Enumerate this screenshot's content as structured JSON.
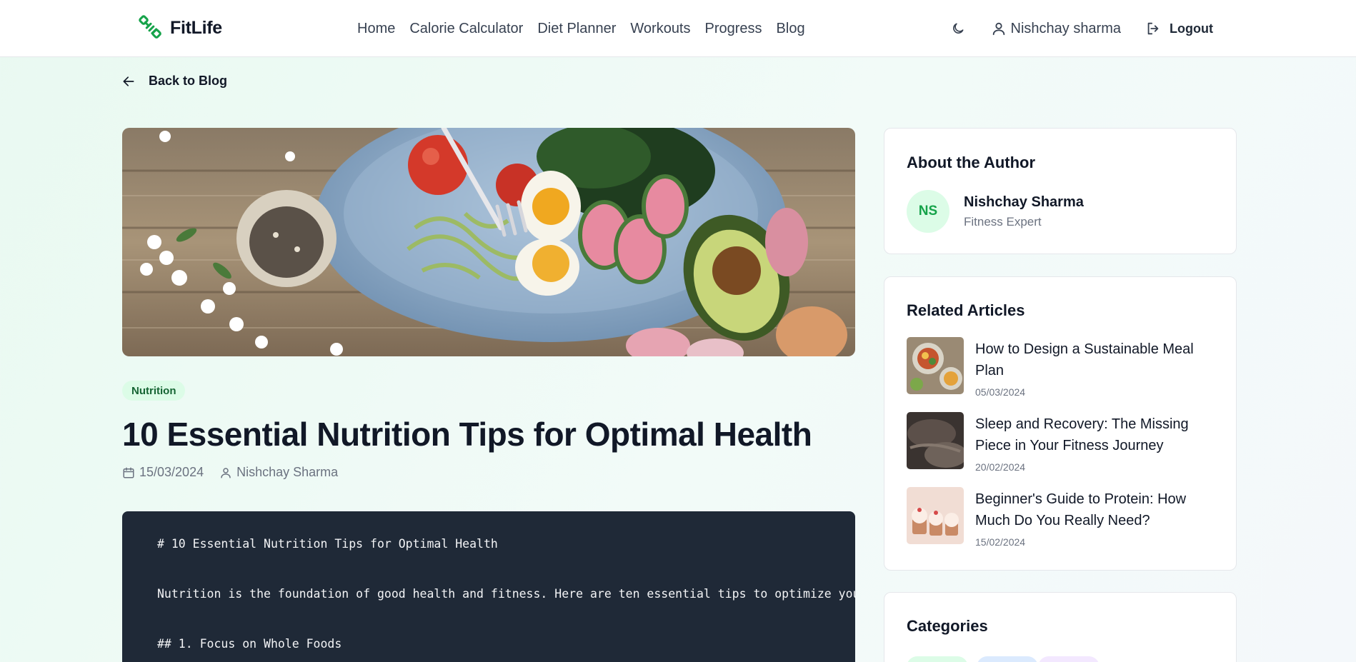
{
  "header": {
    "brand": "FitLife",
    "nav": [
      "Home",
      "Calorie Calculator",
      "Diet Planner",
      "Workouts",
      "Progress",
      "Blog"
    ],
    "user_name": "Nishchay sharma",
    "logout_label": "Logout"
  },
  "back_link": "Back to Blog",
  "article": {
    "category": "Nutrition",
    "title": "10 Essential Nutrition Tips for Optimal Health",
    "date": "15/03/2024",
    "author": "Nishchay Sharma",
    "content_lines": [
      "# 10 Essential Nutrition Tips for Optimal Health",
      "Nutrition is the foundation of good health and fitness. Here are ten essential tips to optimize your",
      "## 1. Focus on Whole Foods"
    ]
  },
  "sidebar": {
    "author_card": {
      "title": "About the Author",
      "initials": "NS",
      "name": "Nishchay Sharma",
      "role": "Fitness Expert"
    },
    "related": {
      "title": "Related Articles",
      "items": [
        {
          "title": "How to Design a Sustainable Meal Plan",
          "date": "05/03/2024"
        },
        {
          "title": "Sleep and Recovery: The Missing Piece in Your Fitness Journey",
          "date": "20/02/2024"
        },
        {
          "title": "Beginner's Guide to Protein: How Much Do You Really Need?",
          "date": "15/02/2024"
        }
      ]
    },
    "categories": {
      "title": "Categories"
    }
  },
  "colors": {
    "brand_green": "#16a34a",
    "code_bg": "#1f2937",
    "tag_bg": "#dcfce7"
  }
}
